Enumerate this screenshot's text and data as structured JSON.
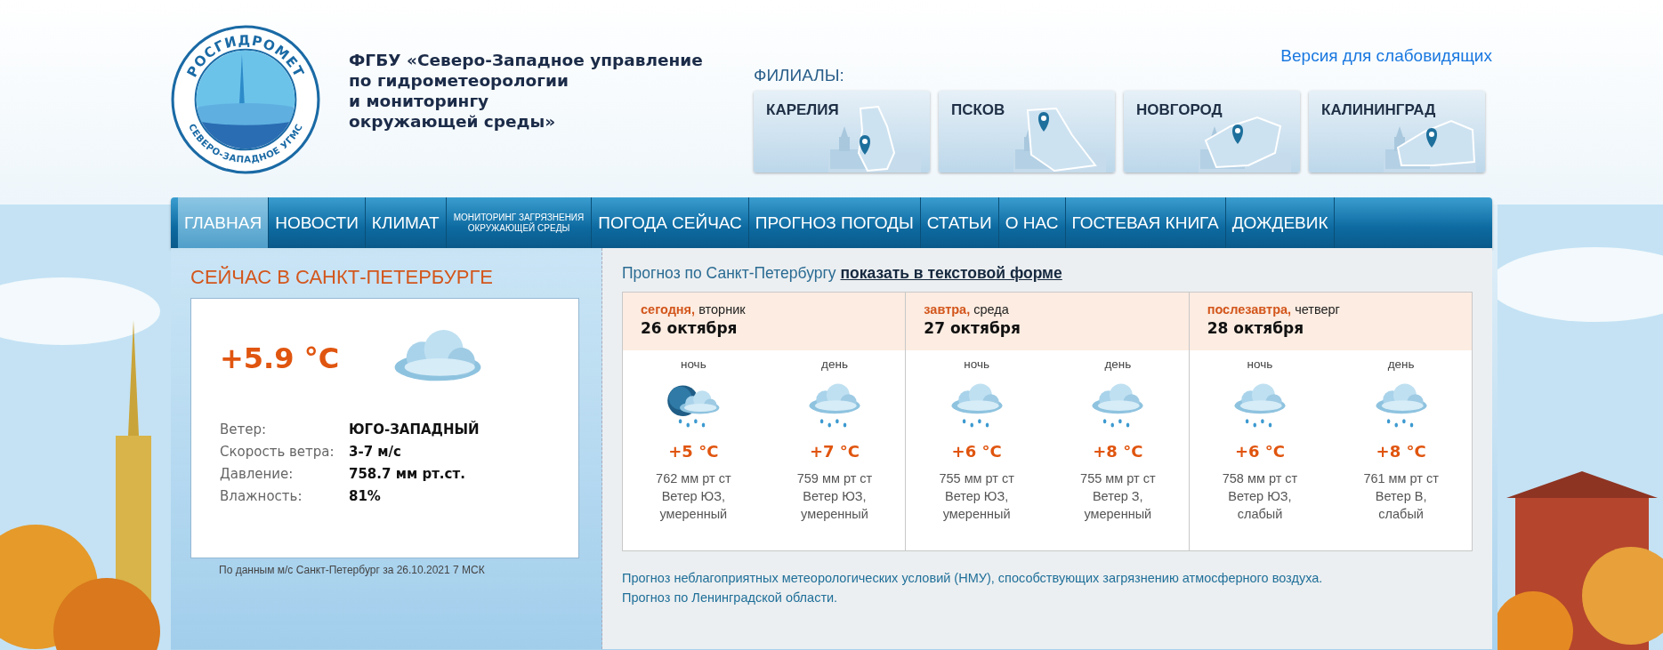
{
  "header": {
    "logo": {
      "top_text": "РОСГИДРОМЕТ",
      "bottom_text": "СЕВЕРО-ЗАПАДНОЕ УГМС"
    },
    "org_name": "ФГБУ «Северо-Западное управление\nпо гидрометеорологии\nи мониторингу\nокружающей среды»",
    "accessibility_link": "Версия для слабовидящих",
    "branches_label": "ФИЛИАЛЫ:",
    "branches": [
      {
        "name": "КАРЕЛИЯ"
      },
      {
        "name": "ПСКОВ"
      },
      {
        "name": "НОВГОРОД"
      },
      {
        "name": "КАЛИНИНГРАД"
      }
    ]
  },
  "nav": [
    {
      "label": "ГЛАВНАЯ",
      "selected": true,
      "kind": "normal"
    },
    {
      "label": "НОВОСТИ",
      "selected": false,
      "kind": "normal"
    },
    {
      "label": "КЛИМАТ",
      "selected": false,
      "kind": "normal"
    },
    {
      "label": "МОНИТОРИНГ ЗАГРЯЗНЕНИЯ\nОКРУЖАЮЩЕЙ СРЕДЫ",
      "selected": false,
      "kind": "small"
    },
    {
      "label": "ПОГОДА СЕЙЧАС",
      "selected": false,
      "kind": "normal"
    },
    {
      "label": "ПРОГНОЗ ПОГОДЫ",
      "selected": false,
      "kind": "normal"
    },
    {
      "label": "СТАТЬИ",
      "selected": false,
      "kind": "normal"
    },
    {
      "label": "О НАС",
      "selected": false,
      "kind": "normal"
    },
    {
      "label": "ГОСТЕВАЯ КНИГА",
      "selected": false,
      "kind": "normal"
    },
    {
      "label": "ДОЖДЕВИК",
      "selected": false,
      "kind": "normal"
    }
  ],
  "current": {
    "title": "СЕЙЧАС В САНКТ-ПЕТЕРБУРГЕ",
    "temperature": "+5.9 °C",
    "kind": "cloudy",
    "rows": [
      {
        "label": "Ветер:",
        "value": "ЮГО-ЗАПАДНЫЙ"
      },
      {
        "label": "Скорость ветра:",
        "value": "3-7 м/с"
      },
      {
        "label": "Давление:",
        "value": "758.7 мм рт.ст."
      },
      {
        "label": "Влажность:",
        "value": "81%"
      }
    ],
    "source_note": "По данным м/с Санкт-Петербург за 26.10.2021 7 МСК"
  },
  "forecast": {
    "heading": "Прогноз по Санкт-Петербургу",
    "text_link": "показать в текстовой форме",
    "days": [
      {
        "label": "сегодня,",
        "weekday": "вторник",
        "date": "26 октября",
        "periods": [
          {
            "name": "ночь",
            "kind": "night_rain",
            "temp": "+5 °C",
            "pressure": "762 мм рт ст",
            "wind": "Ветер ЮЗ,\nумеренный"
          },
          {
            "name": "день",
            "kind": "rain",
            "temp": "+7 °C",
            "pressure": "759 мм рт ст",
            "wind": "Ветер ЮЗ,\nумеренный"
          }
        ]
      },
      {
        "label": "завтра,",
        "weekday": "среда",
        "date": "27 октября",
        "periods": [
          {
            "name": "ночь",
            "kind": "rain",
            "temp": "+6 °C",
            "pressure": "755 мм рт ст",
            "wind": "Ветер ЮЗ,\nумеренный"
          },
          {
            "name": "день",
            "kind": "rain",
            "temp": "+8 °C",
            "pressure": "755 мм рт ст",
            "wind": "Ветер З,\nумеренный"
          }
        ]
      },
      {
        "label": "послезавтра,",
        "weekday": "четверг",
        "date": "28 октября",
        "periods": [
          {
            "name": "ночь",
            "kind": "rain",
            "temp": "+6 °C",
            "pressure": "758 мм рт ст",
            "wind": "Ветер ЮЗ,\nслабый"
          },
          {
            "name": "день",
            "kind": "rain",
            "temp": "+8 °C",
            "pressure": "761 мм рт ст",
            "wind": "Ветер В,\nслабый"
          }
        ]
      }
    ],
    "links": [
      "Прогноз неблагоприятных метеорологических условий (НМУ), способствующих загрязнению атмосферного воздуха.",
      "Прогноз по Ленинградской области."
    ]
  }
}
